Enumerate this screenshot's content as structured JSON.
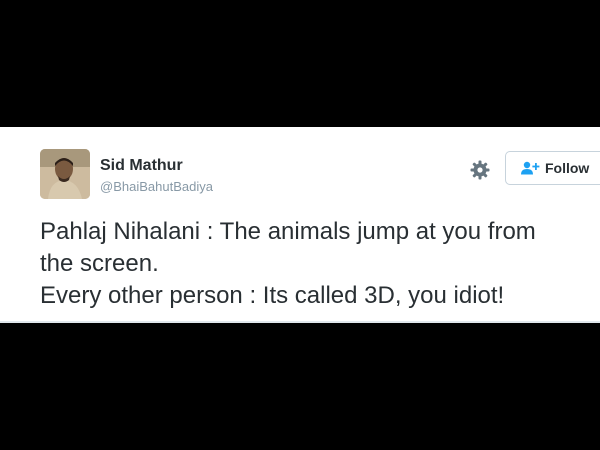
{
  "tweet": {
    "user": {
      "display_name": "Sid Mathur",
      "handle": "@BhaiBahutBadiya",
      "avatar_icon": "user-avatar-photo"
    },
    "actions": {
      "settings_icon": "gear-icon",
      "follow_label": "Follow",
      "follow_icon": "add-user-icon"
    },
    "text_lines": [
      "Pahlaj Nihalani : The animals jump at you from",
      "the screen.",
      "Every other person : Its called 3D, you idiot!"
    ]
  },
  "colors": {
    "background": "#000000",
    "card": "#ffffff",
    "text": "#292f33",
    "muted": "#8899a6",
    "accent": "#1da1f2"
  }
}
